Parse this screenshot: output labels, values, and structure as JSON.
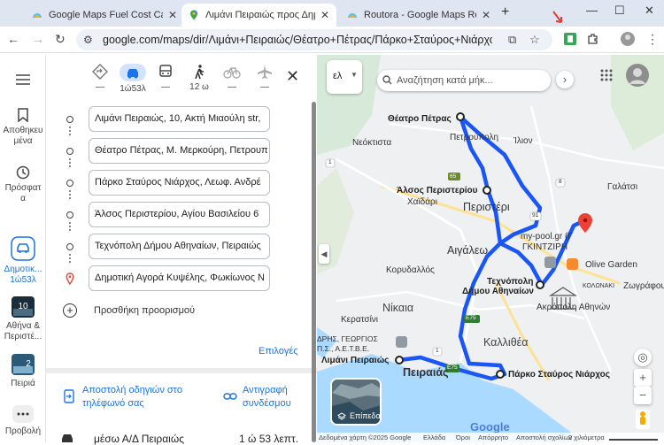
{
  "browser": {
    "tabs": [
      {
        "title": "Google Maps Fuel Cost Calculat",
        "active": false
      },
      {
        "title": "Λιμάνι Πειραιώς προς Δημοτικ",
        "active": true
      },
      {
        "title": "Routora - Google Maps Route O",
        "active": false
      }
    ],
    "url": "google.com/maps/dir/Λιμάνι+Πειραιώς/Θέατρο+Πέτρας/Πάρκο+Σταύρος+Νιάρχος/Άλσος+..."
  },
  "rail": {
    "saved": "Αποθηκευ\nμένα",
    "saved_l1": "Αποθηκευ",
    "saved_l2": "μένα",
    "recent_l1": "Πρόσφατ",
    "recent_l2": "α",
    "route_l1": "Δημοτικ...",
    "route_l2": "1ώ53λ",
    "trip1_badge": "10",
    "trip1_l1": "Αθήνα &",
    "trip1_l2": "Περιστέ...",
    "trip2_badge": "2",
    "trip2_l1": "Πειριά",
    "more_l1": "Προβολή"
  },
  "modes": {
    "car_time": "1ώ53λ",
    "walk_time": "12 ω",
    "dash1": "—",
    "dash2": "—",
    "dash3": "—",
    "dash4": "—"
  },
  "stops": [
    "Λιμάνι Πειραιώς, 10, Ακτή Μιαούλη str,",
    "Θέατρο Πέτρας, Μ. Μερκούρη, Πετρουπ",
    "Πάρκο Σταύρος Νιάρχος, Λεωφ. Ανδρέ",
    "Άλσος Περιστερίου, Αγίου Βασιλείου 6",
    "Τεχνόπολη Δήμου Αθηναίων, Πειραιώς",
    "Δημοτική Αγορά Κυψέλης, Φωκίωνος Ν"
  ],
  "add_destination": "Προσθήκη προορισμού",
  "options": "Επιλογές",
  "share": {
    "send_l1": "Αποστολή οδηγιών στο",
    "send_l2": "τηλέφωνό σας",
    "copy_l1": "Αντιγραφή",
    "copy_l2": "συνδέσμου"
  },
  "route_summary": {
    "via": "μέσω Α/Δ Πειραιώς",
    "time": "1 ώ 53 λεπτ."
  },
  "map": {
    "search_placeholder": "Αναζήτηση κατά μήκ...",
    "lang": "ελ",
    "labels": {
      "theatro": "Θέατρο Πέτρας",
      "petroupoli": "Πετρούπολη",
      "ilion": "Ίλιον",
      "neoktistia": "Νεόκτιστα",
      "alsos": "Άλσος Περιστερίου",
      "xaidari": "Χαϊδάρι",
      "peristeri": "Περιστέρι",
      "galatsi": "Γαλάτσι",
      "aigaleo": "Αιγάλεω",
      "mypool": "my-pool.gr (Γ",
      "gkintziri": "ΓΚΙΝΤΖΙΡΗ",
      "olive": "Olive Garden",
      "korydallos": "Κορυδαλλός",
      "technopoli1": "Τεχνόπολη",
      "technopoli2": "Δήμου Αθηναίων",
      "kolonaki": "ΚΟΛΩΝΑΚΙ",
      "zografou": "Ζωγράφου",
      "acropolis": "Ακρόπολη Αθηνών",
      "nikaia": "Νίκαια",
      "keratsini": "Κερατσίνι",
      "kallithea": "Καλλιθέα",
      "agios": "ΔΡΗΣ, ΓΕΩΡΓΙΟΣ",
      "agios2": "Π.Σ., Α.Ε.Τ.Β.Ε.",
      "limani": "Λιμάνι Πειραιώς",
      "pireas": "Πειραιάς",
      "parko": "Πάρκο Σταύρος Νιάρχος",
      "e75a": "E75",
      "e75b": "E75",
      "r65": "65",
      "r1a": "1",
      "r1b": "1",
      "r8": "8",
      "r91": "91",
      "layers": "Επίπεδα",
      "google": "Google"
    },
    "footer": {
      "data": "Δεδομένα χάρτη ©2025 Google",
      "country": "Ελλάδα",
      "terms": "Όροι",
      "privacy": "Απόρρητο",
      "feedback": "Αποστολή σχολίων",
      "scale": "2 χιλιόμετρα"
    },
    "colors": {
      "route": "#1a55f5",
      "destination_pin": "#ea4335",
      "accent": "#1a73e8"
    }
  }
}
